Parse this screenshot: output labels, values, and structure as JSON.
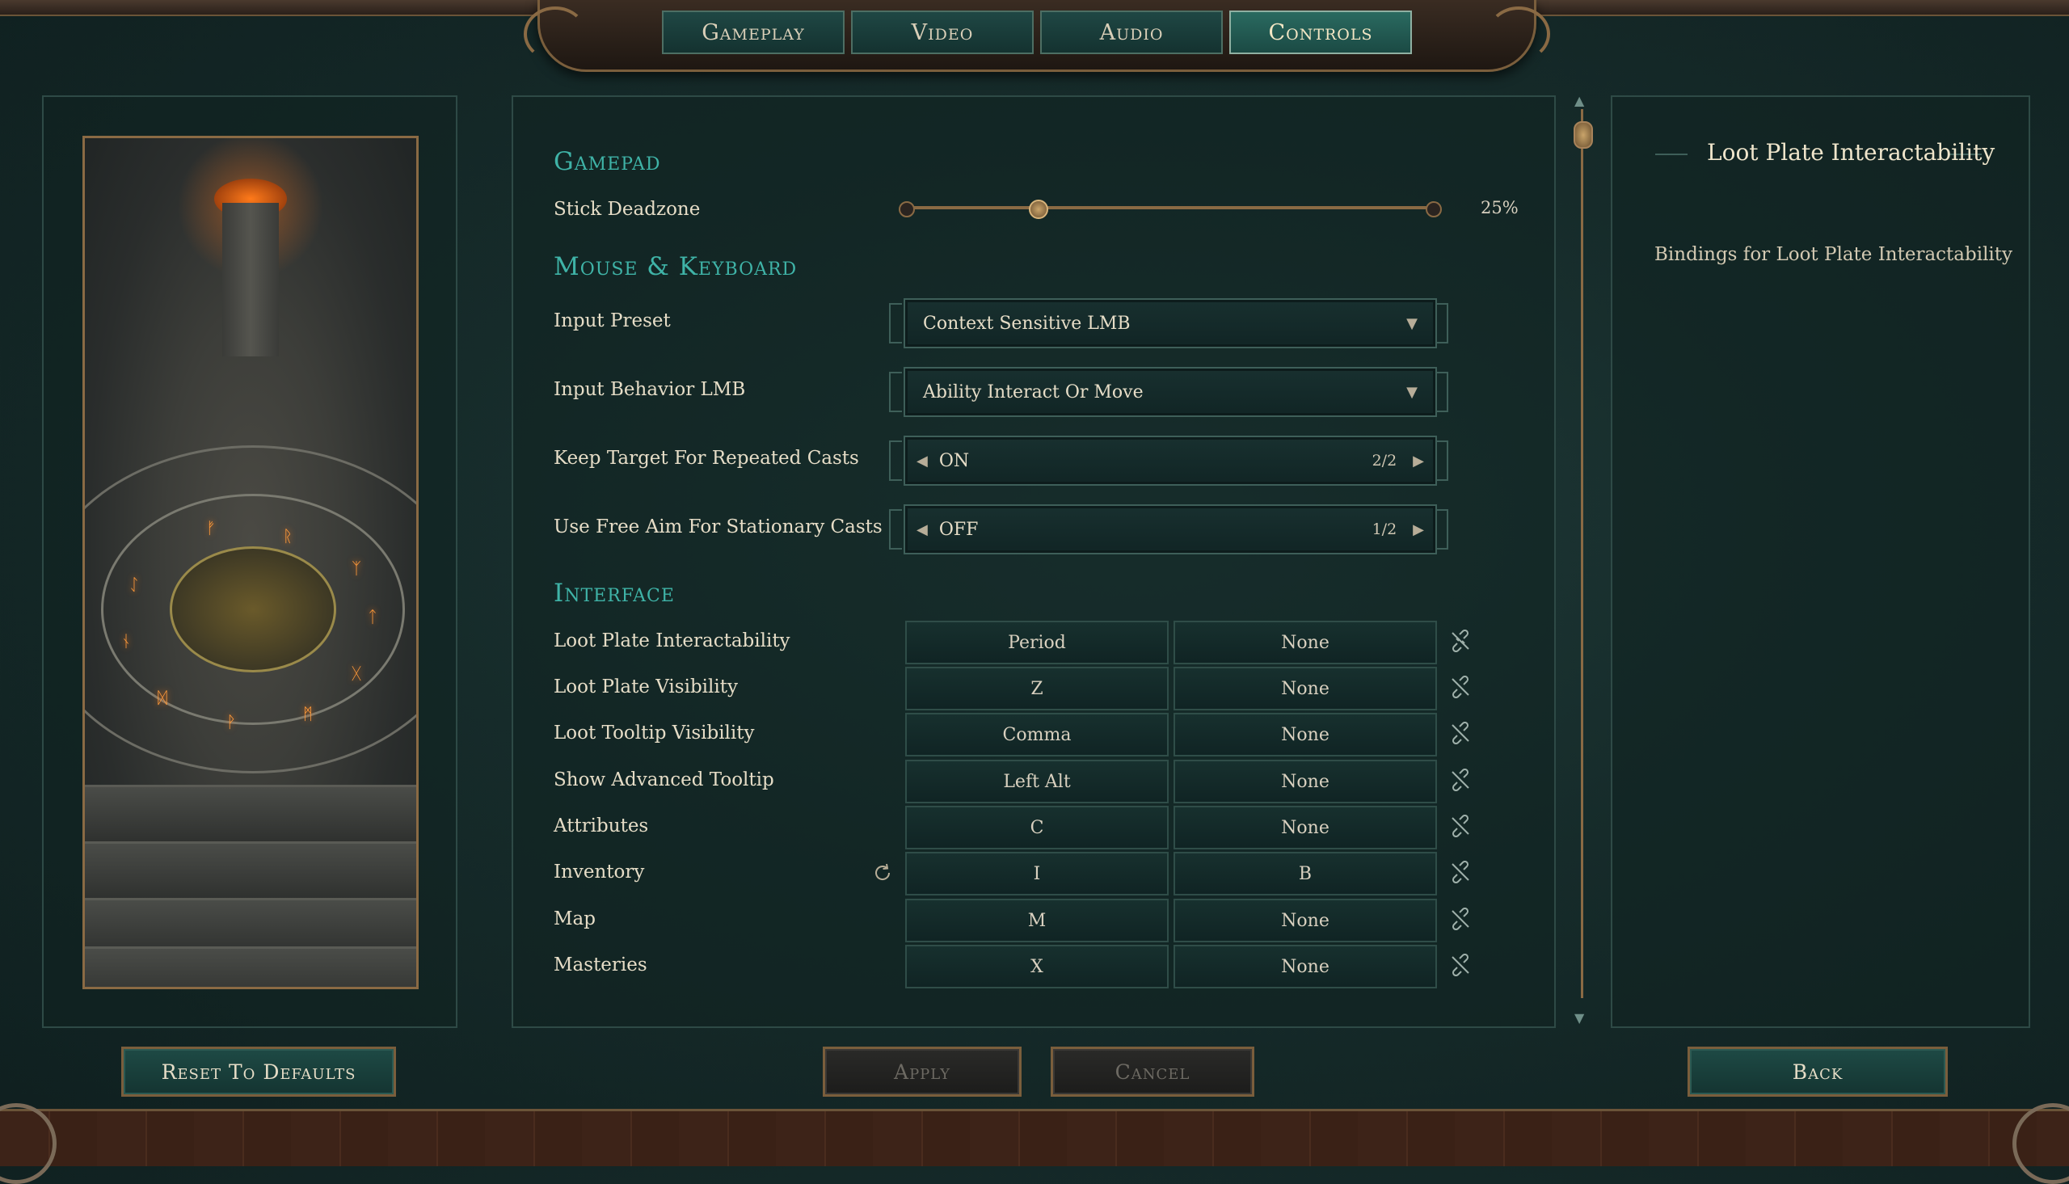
{
  "tabs": [
    "Gameplay",
    "Video",
    "Audio",
    "Controls"
  ],
  "active_tab": "Controls",
  "sections": {
    "gamepad": "Gamepad",
    "mouse_keyboard": "Mouse & Keyboard",
    "interface": "Interface"
  },
  "gamepad": {
    "stick_deadzone": {
      "label": "Stick Deadzone",
      "value": 25,
      "value_text": "25%"
    }
  },
  "mouse_keyboard": {
    "input_preset": {
      "label": "Input Preset",
      "value": "Context Sensitive LMB"
    },
    "input_behavior": {
      "label": "Input Behavior LMB",
      "value": "Ability Interact Or Move"
    },
    "keep_target": {
      "label": "Keep Target For Repeated Casts",
      "value": "ON",
      "count": "2/2"
    },
    "free_aim": {
      "label": "Use Free Aim For Stationary Casts",
      "value": "OFF",
      "count": "1/2"
    }
  },
  "bindings": [
    {
      "label": "Loot Plate Interactability",
      "primary": "Period",
      "secondary": "None"
    },
    {
      "label": "Loot Plate Visibility",
      "primary": "Z",
      "secondary": "None"
    },
    {
      "label": "Loot Tooltip Visibility",
      "primary": "Comma",
      "secondary": "None"
    },
    {
      "label": "Show Advanced Tooltip",
      "primary": "Left Alt",
      "secondary": "None"
    },
    {
      "label": "Attributes",
      "primary": "C",
      "secondary": "None"
    },
    {
      "label": "Inventory",
      "primary": "I",
      "secondary": "B"
    },
    {
      "label": "Map",
      "primary": "M",
      "secondary": "None"
    },
    {
      "label": "Masteries",
      "primary": "X",
      "secondary": "None"
    }
  ],
  "description": {
    "title": "Loot Plate Interactability",
    "text": "Bindings for Loot Plate Interactability"
  },
  "buttons": {
    "reset": "Reset To Defaults",
    "apply": "Apply",
    "cancel": "Cancel",
    "back": "Back"
  },
  "colors": {
    "section_title": "#3fb3a7",
    "accent_bronze": "#8a6a44",
    "background": "#162b2a"
  }
}
